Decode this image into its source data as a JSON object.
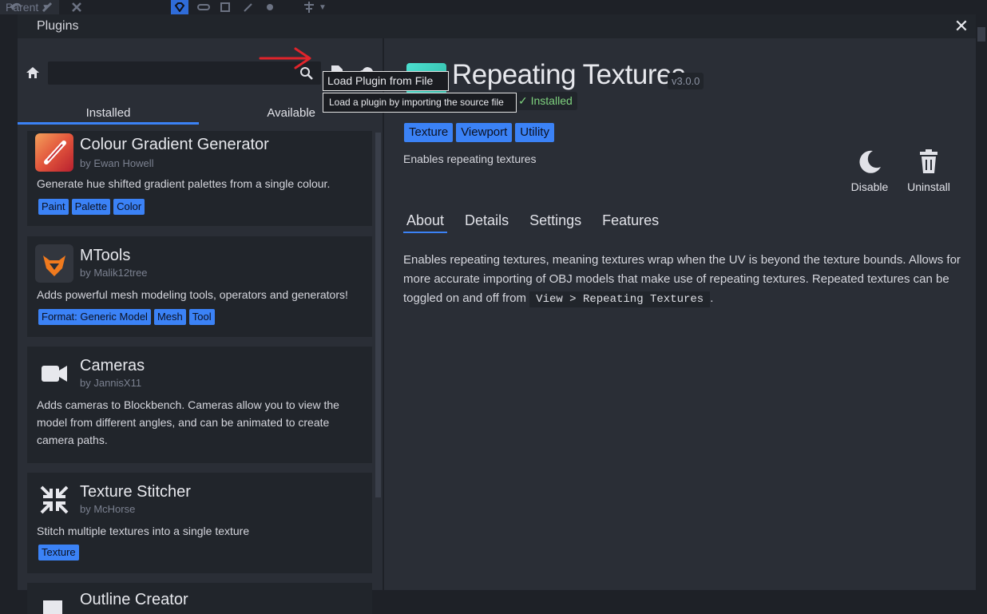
{
  "toolbar": {
    "parent_label": "Parent"
  },
  "dialog": {
    "title": "Plugins",
    "close": "✕"
  },
  "tabs": {
    "installed": "Installed",
    "available": "Available"
  },
  "plugins": [
    {
      "name": "Colour Gradient Generator",
      "author": "by Ewan Howell",
      "description": "Generate hue shifted gradient palettes from a single colour.",
      "tags": [
        "Paint",
        "Palette",
        "Color"
      ]
    },
    {
      "name": "MTools",
      "author": "by Malik12tree",
      "description": "Adds powerful mesh modeling tools, operators and generators!",
      "tags": [
        "Format: Generic Model",
        "Mesh",
        "Tool"
      ]
    },
    {
      "name": "Cameras",
      "author": "by JannisX11",
      "description": "Adds cameras to Blockbench. Cameras allow you to view the model from different angles, and can be animated to create camera paths.",
      "tags": []
    },
    {
      "name": "Texture Stitcher",
      "author": "by McHorse",
      "description": "Stitch multiple textures into a single texture",
      "tags": [
        "Texture"
      ]
    },
    {
      "name": "Outline Creator",
      "author": "",
      "description": "",
      "tags": []
    }
  ],
  "detail": {
    "title": "Repeating Textures",
    "version": "v3.0.0",
    "installed": "✓ Installed",
    "tags": [
      "Texture",
      "Viewport",
      "Utility"
    ],
    "short": "Enables repeating textures",
    "disable": "Disable",
    "uninstall": "Uninstall",
    "tabs": [
      "About",
      "Details",
      "Settings",
      "Features"
    ],
    "about_text": "Enables repeating textures, meaning textures wrap when the UV is beyond the texture bounds. Allows for more accurate importing of OBJ models that make use of repeating textures. Repeated textures can be toggled on and off from ",
    "about_code": "View > Repeating Textures",
    "about_end": "."
  },
  "tooltip": {
    "title": "Load Plugin from File",
    "description": "Load a plugin by importing the source file"
  },
  "colors": {
    "accent": "#3b82f6",
    "installed": "#7fd37f",
    "arrow": "#e0242b"
  }
}
